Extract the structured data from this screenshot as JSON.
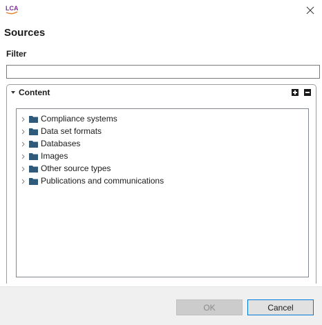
{
  "window": {
    "app_icon_text": "LCA",
    "close_symbol": "×"
  },
  "dialog": {
    "title": "Sources"
  },
  "filter": {
    "label": "Filter",
    "value": "",
    "placeholder": ""
  },
  "content_section": {
    "title": "Content",
    "expand_all_icon": "plus-square-icon",
    "collapse_all_icon": "minus-square-icon",
    "tree_items": [
      {
        "label": "Compliance systems",
        "icon": "folder-icon",
        "expanded": false
      },
      {
        "label": "Data set formats",
        "icon": "folder-icon",
        "expanded": false
      },
      {
        "label": "Databases",
        "icon": "folder-icon",
        "expanded": false
      },
      {
        "label": "Images",
        "icon": "folder-icon",
        "expanded": false
      },
      {
        "label": "Other source types",
        "icon": "folder-icon",
        "expanded": false
      },
      {
        "label": "Publications and communications",
        "icon": "folder-icon",
        "expanded": false
      }
    ]
  },
  "buttons": {
    "ok_label": "OK",
    "ok_enabled": false,
    "cancel_label": "Cancel"
  },
  "colors": {
    "folder": "#2f5a7a",
    "focus_border": "#0078d7",
    "footer_bg": "#f0f0f0",
    "logo_purple": "#7b2f8f",
    "logo_orange": "#e8832a"
  }
}
